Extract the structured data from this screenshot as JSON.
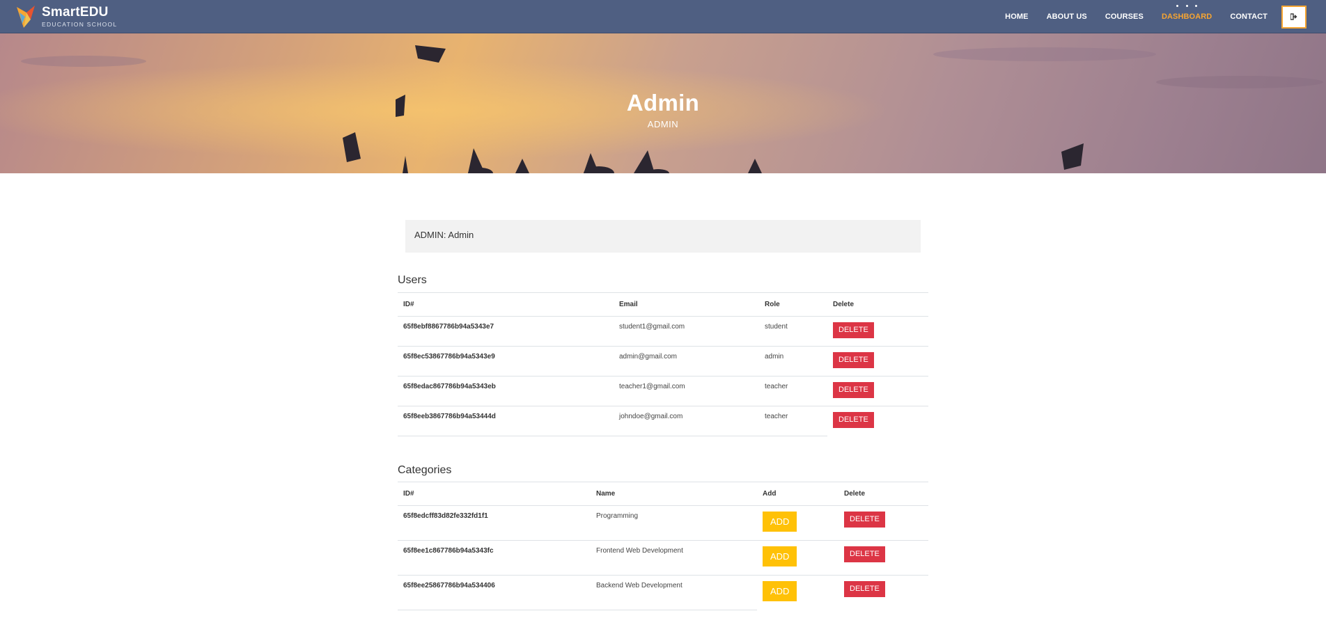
{
  "brand": {
    "title": "SmartEDU",
    "subtitle": "EDUCATION SCHOOL"
  },
  "nav": {
    "items": [
      {
        "label": "HOME"
      },
      {
        "label": "ABOUT US"
      },
      {
        "label": "COURSES"
      },
      {
        "label": "DASHBOARD",
        "active": true
      },
      {
        "label": "CONTACT"
      }
    ],
    "logout_icon": "sign-out-icon"
  },
  "hero": {
    "title": "Admin",
    "subtitle": "ADMIN"
  },
  "admin_info": "ADMIN: Admin",
  "users": {
    "title": "Users",
    "columns": [
      "ID#",
      "Email",
      "Role",
      "Delete"
    ],
    "rows": [
      {
        "id": "65f8ebf8867786b94a5343e7",
        "email": "student1@gmail.com",
        "role": "student",
        "action": "DELETE"
      },
      {
        "id": "65f8ec53867786b94a5343e9",
        "email": "admin@gmail.com",
        "role": "admin",
        "action": "DELETE"
      },
      {
        "id": "65f8edac867786b94a5343eb",
        "email": "teacher1@gmail.com",
        "role": "teacher",
        "action": "DELETE"
      },
      {
        "id": "65f8eeb3867786b94a53444d",
        "email": "johndoe@gmail.com",
        "role": "teacher",
        "action": "DELETE"
      }
    ]
  },
  "categories": {
    "title": "Categories",
    "columns": [
      "ID#",
      "Name",
      "Add",
      "Delete"
    ],
    "rows": [
      {
        "id": "65f8edcff83d82fe332fd1f1",
        "name": "Programming",
        "add": "ADD",
        "delete": "DELETE"
      },
      {
        "id": "65f8ee1c867786b94a5343fc",
        "name": "Frontend Web Development",
        "add": "ADD",
        "delete": "DELETE"
      },
      {
        "id": "65f8ee25867786b94a534406",
        "name": "Backend Web Development",
        "add": "ADD",
        "delete": "DELETE"
      }
    ]
  },
  "colors": {
    "navbar": "#4f5f82",
    "accent": "#f7a531",
    "danger": "#dc3545",
    "warning": "#ffc107",
    "admin_box": "#f2f2f2"
  }
}
